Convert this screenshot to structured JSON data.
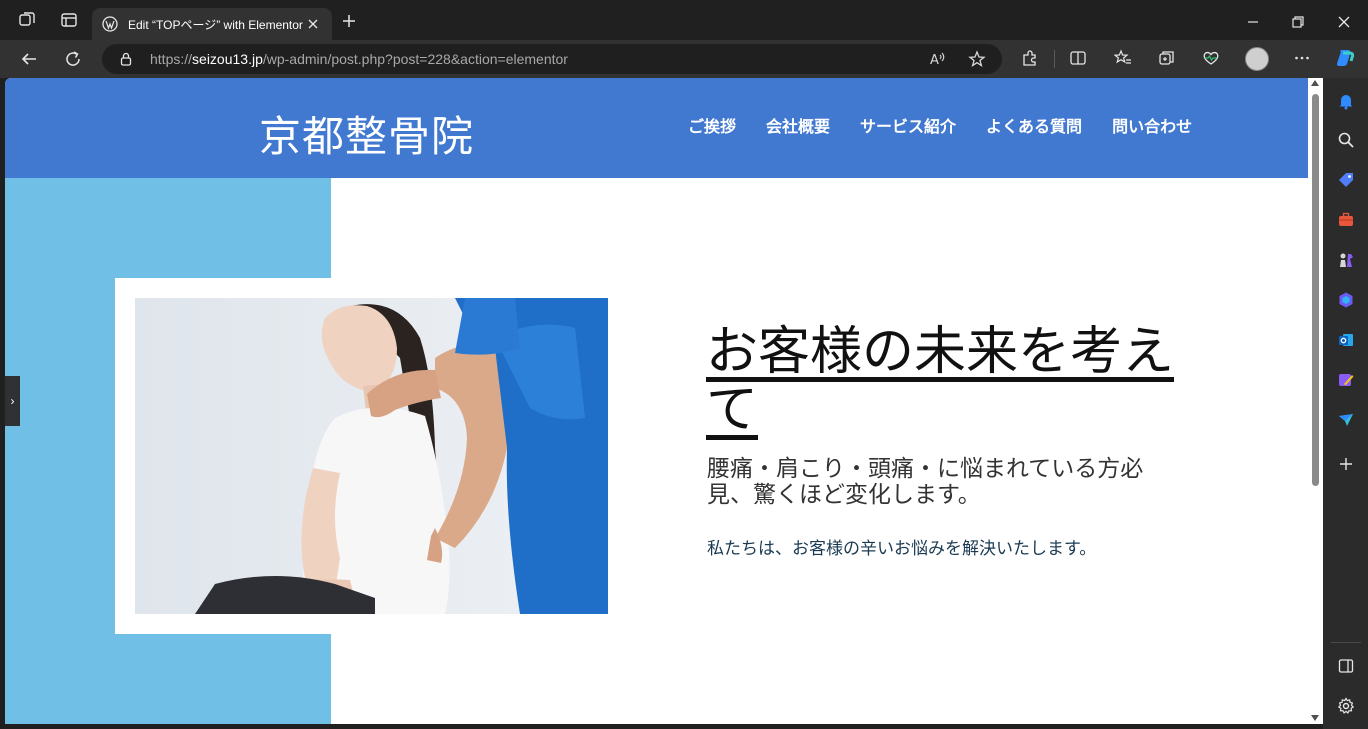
{
  "browser": {
    "tab": {
      "title": "Edit “TOPページ” with Elementor"
    },
    "address": {
      "scheme": "https://",
      "host": "seizou13.jp",
      "path": "/wp-admin/post.php?post=228&action=elementor"
    },
    "icons": {
      "workspaces": "workspaces-icon",
      "tab_actions": "tab-actions-icon",
      "new_tab": "plus-icon",
      "minimize": "minimize-icon",
      "maximize": "restore-icon",
      "close": "close-icon",
      "back": "back-arrow-icon",
      "refresh": "refresh-icon",
      "lock": "lock-icon",
      "read_aloud": "read-aloud-icon",
      "favorite": "star-icon",
      "extensions": "puzzle-icon",
      "split": "split-screen-icon",
      "favorites": "favorites-icon",
      "collections": "collections-icon",
      "health": "heart-pulse-icon",
      "more": "more-icon",
      "copilot": "copilot-icon"
    }
  },
  "sidebar": {
    "items": [
      "bell-icon",
      "search-icon",
      "tag-icon",
      "briefcase-icon",
      "chess-icon",
      "copilot-app-icon",
      "outlook-icon",
      "designer-icon",
      "send-icon",
      "add-icon"
    ],
    "bottom": [
      "sidebar-toggle-icon",
      "settings-icon"
    ]
  },
  "site": {
    "logo": "京都整骨院",
    "nav": [
      "ご挨拶",
      "会社概要",
      "サービス紹介",
      "よくある質問",
      "問い合わせ"
    ],
    "hero": {
      "title": "お客様の未来を考えて",
      "subtitle": "腰痛・肩こり・頭痛・に悩まれている方必見、驚くほど変化します。",
      "text": "私たちは、お客様の辛いお悩みを解決いたします。"
    },
    "colors": {
      "header": "#4178d0",
      "accent_block": "#6fbfe6"
    }
  },
  "editor": {
    "panel_toggle": "›"
  }
}
